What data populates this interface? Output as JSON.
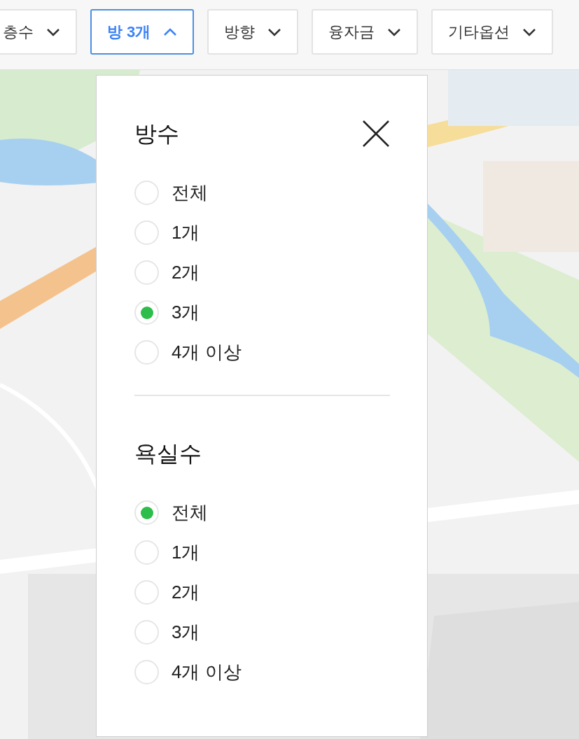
{
  "filters": [
    {
      "label": "층수",
      "selected": false
    },
    {
      "label": "방 3개",
      "selected": true
    },
    {
      "label": "방향",
      "selected": false
    },
    {
      "label": "융자금",
      "selected": false
    },
    {
      "label": "기타옵션",
      "selected": false
    }
  ],
  "panel": {
    "sections": [
      {
        "title": "방수",
        "options": [
          {
            "label": "전체",
            "selected": false
          },
          {
            "label": "1개",
            "selected": false
          },
          {
            "label": "2개",
            "selected": false
          },
          {
            "label": "3개",
            "selected": true
          },
          {
            "label": "4개 이상",
            "selected": false
          }
        ]
      },
      {
        "title": "욕실수",
        "options": [
          {
            "label": "전체",
            "selected": true
          },
          {
            "label": "1개",
            "selected": false
          },
          {
            "label": "2개",
            "selected": false
          },
          {
            "label": "3개",
            "selected": false
          },
          {
            "label": "4개 이상",
            "selected": false
          }
        ]
      }
    ]
  }
}
